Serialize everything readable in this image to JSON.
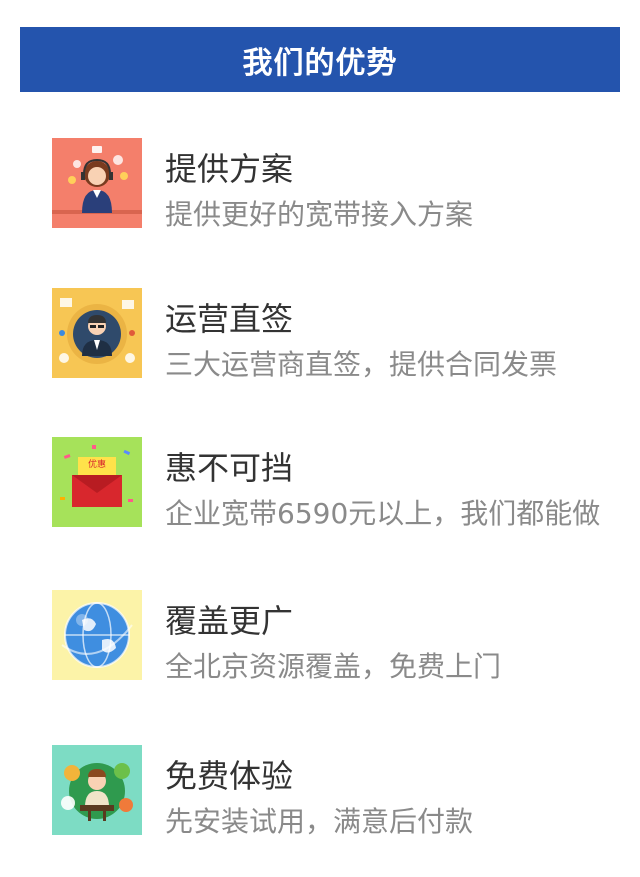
{
  "header": {
    "title": "我们的优势"
  },
  "items": [
    {
      "title": "提供方案",
      "subtitle": "提供更好的宽带接入方案",
      "icon": "customer-service-icon",
      "bg": "#f47f6b"
    },
    {
      "title": "运营直签",
      "subtitle": "三大运营商直签，提供合同发票",
      "icon": "business-man-icon",
      "bg": "#f7c654"
    },
    {
      "title": "惠不可挡",
      "subtitle": "企业宽带6590元以上，我们都能做",
      "icon": "red-envelope-icon",
      "bg": "#a6e25a",
      "badge": "优惠"
    },
    {
      "title": "覆盖更广",
      "subtitle": "全北京资源覆盖，免费上门",
      "icon": "globe-icon",
      "bg": "#fcf3a8"
    },
    {
      "title": "免费体验",
      "subtitle": "先安装试用，满意后付款",
      "icon": "person-desk-icon",
      "bg": "#7ddcc4"
    }
  ]
}
